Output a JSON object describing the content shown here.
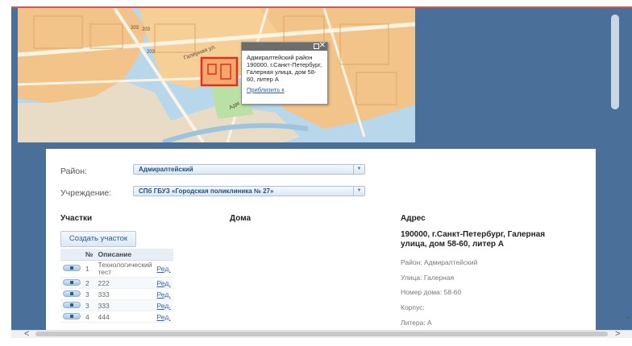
{
  "map": {
    "labels": [
      "203",
      "203",
      "203",
      "Галерная ул.",
      "Адм"
    ],
    "popup": {
      "text": "Адмиралтейский район 190000, г.Санкт-Петербург, Галерная улица, дом 58-60, литер А",
      "link": "Приблизить к",
      "close_symbol": "✕",
      "max_icon": "window-maximize-icon"
    }
  },
  "form": {
    "district_label": "Район:",
    "district_value": "Адмиралтейский",
    "institution_label": "Учреждение:",
    "institution_value": "СПб ГБУЗ «Городская поликлиника № 27»",
    "dropdown_arrow": "▼"
  },
  "columns": {
    "plots": "Участки",
    "houses": "Дома",
    "address": "Адрес"
  },
  "plots": {
    "create_button": "Создать участок",
    "table_headers": [
      "№",
      "Описание"
    ],
    "rows": [
      {
        "num": "1",
        "desc": "Технологический тест",
        "edit": "Ред."
      },
      {
        "num": "2",
        "desc": "222",
        "edit": "Ред."
      },
      {
        "num": "3",
        "desc": "333",
        "edit": "Ред."
      },
      {
        "num": "3",
        "desc": "333",
        "edit": "Ред."
      },
      {
        "num": "4",
        "desc": "444",
        "edit": "Ред."
      }
    ]
  },
  "address": {
    "title": "190000, г.Санкт-Петербург, Галерная улица, дом 58-60, литер А",
    "district": "Район: Адмиралтейский",
    "street": "Улица: Галерная",
    "house_number": "Номер дома: 58-60",
    "building": "Корпус:",
    "letter": "Литера: А"
  },
  "scrollbar": {
    "left_arrow": "<",
    "right_arrow": ">",
    "corner": "⌄"
  }
}
